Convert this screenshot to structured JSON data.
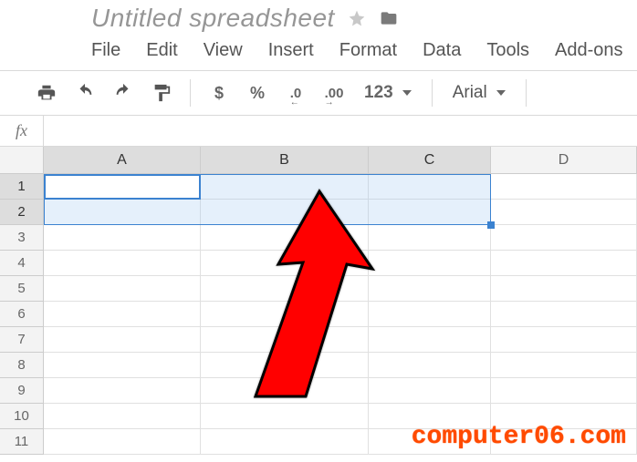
{
  "header": {
    "title": "Untitled spreadsheet"
  },
  "menu": {
    "file": "File",
    "edit": "Edit",
    "view": "View",
    "insert": "Insert",
    "format": "Format",
    "data": "Data",
    "tools": "Tools",
    "addons": "Add-ons"
  },
  "toolbar": {
    "currency": "$",
    "percent": "%",
    "dec_dec": ".0",
    "dec_inc": ".00",
    "number_format": "123",
    "font": "Arial"
  },
  "formula_bar": {
    "label": "fx",
    "value": ""
  },
  "grid": {
    "columns": [
      "A",
      "B",
      "C",
      "D"
    ],
    "rows": [
      "1",
      "2",
      "3",
      "4",
      "5",
      "6",
      "7",
      "8",
      "9",
      "10",
      "11"
    ],
    "selected_columns": [
      "A",
      "B",
      "C"
    ],
    "selected_rows": [
      "1",
      "2"
    ],
    "active_cell": "A1",
    "selection_range": "A1:C2"
  },
  "watermark": "computer06.com"
}
